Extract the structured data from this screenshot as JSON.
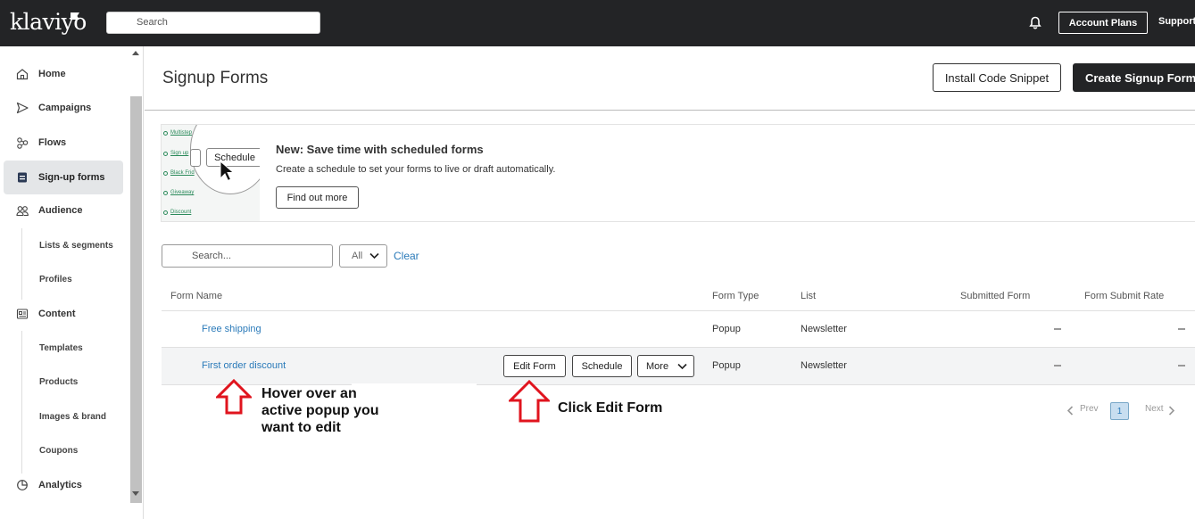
{
  "topbar": {
    "logo": "klaviyo",
    "search_placeholder": "Search",
    "account_plans": "Account Plans",
    "support": "Support"
  },
  "sidebar": {
    "items": [
      {
        "label": "Home",
        "icon": "home-icon"
      },
      {
        "label": "Campaigns",
        "icon": "send-icon"
      },
      {
        "label": "Flows",
        "icon": "flows-icon"
      },
      {
        "label": "Sign-up forms",
        "icon": "form-icon",
        "active": true
      },
      {
        "label": "Audience",
        "icon": "people-icon"
      },
      {
        "label": "Content",
        "icon": "content-icon"
      },
      {
        "label": "Analytics",
        "icon": "analytics-icon"
      }
    ],
    "audience_sub": [
      "Lists & segments",
      "Profiles"
    ],
    "content_sub": [
      "Templates",
      "Products",
      "Images & brand",
      "Coupons"
    ]
  },
  "header": {
    "title": "Signup Forms",
    "install_button": "Install Code Snippet",
    "create_button": "Create Signup Form"
  },
  "banner": {
    "title": "New: Save time with scheduled forms",
    "description": "Create a schedule to set your forms to live or draft automatically.",
    "button": "Find out more",
    "image_items": [
      "Multistep",
      "Sign up",
      "Black Frid",
      "Giveaway",
      "Discount"
    ],
    "image_button": "Schedule"
  },
  "filters": {
    "search_placeholder": "Search...",
    "select_value": "All",
    "clear": "Clear"
  },
  "table": {
    "columns": [
      "Form Name",
      "Form Type",
      "List",
      "Submitted Form",
      "Form Submit Rate"
    ],
    "rows": [
      {
        "name": "Free shipping",
        "type": "Popup",
        "list": "Newsletter"
      },
      {
        "name": "First order discount",
        "type": "Popup",
        "list": "Newsletter"
      }
    ],
    "row_actions": {
      "edit": "Edit Form",
      "schedule": "Schedule",
      "more": "More"
    }
  },
  "annotations": {
    "hover_note_lines": [
      "Hover over an",
      "active popup you",
      "want to edit"
    ],
    "click_note": "Click Edit Form",
    "arrow_color": "#e0141e"
  },
  "pagination": {
    "prev": "Prev",
    "current": "1",
    "next": "Next"
  },
  "colors": {
    "topbar": "#232426",
    "link": "#2a7ab9",
    "active_nav": "#e4e6e8"
  }
}
